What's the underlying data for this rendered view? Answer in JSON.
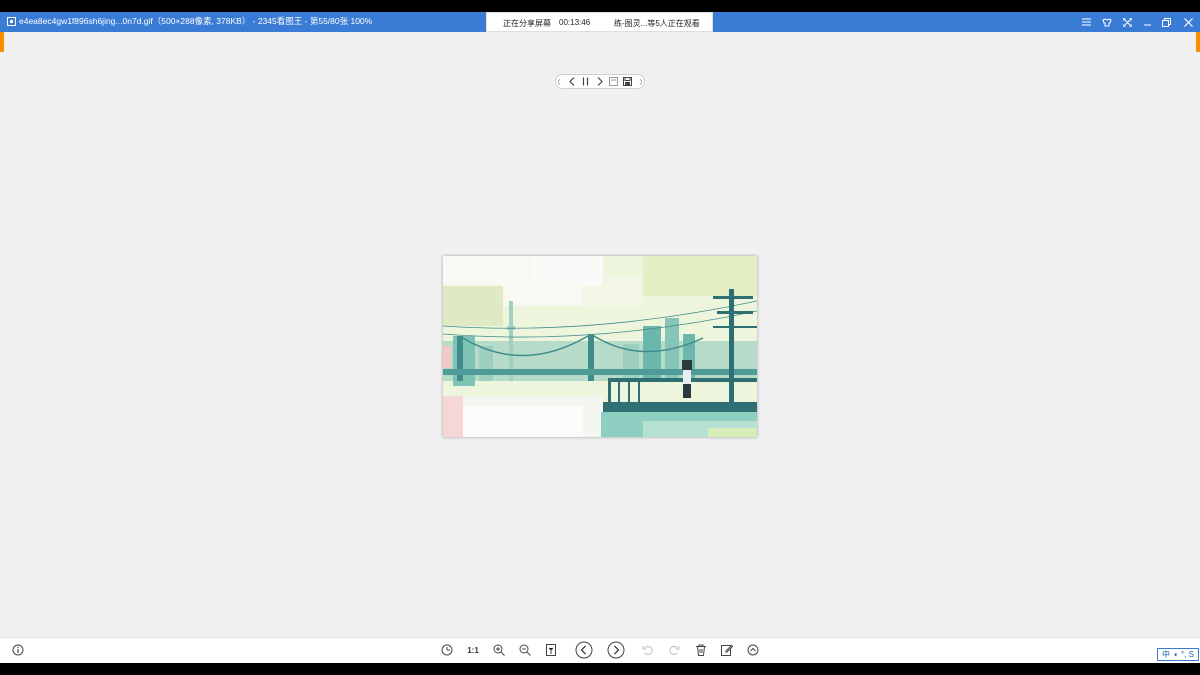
{
  "titlebar": {
    "title": "e4ea8ec4gw1f896sh6jing...0n7d.gif（500×288像素, 378KB） - 2345看图王 - 第55/80张 100%"
  },
  "share_panel": {
    "status": "正在分享屏幕",
    "timer": "00:13:46",
    "viewers": "练-图灵...等5人正在观看"
  },
  "window_controls": [
    "menu-icon",
    "skin-icon",
    "fullscreen-icon",
    "minimize-icon",
    "restore-icon",
    "close-icon"
  ],
  "floating_toolbar": [
    "left-grip-icon",
    "previous-icon",
    "pause-icon",
    "next-icon",
    "frame-icon",
    "save-icon",
    "right-grip-icon"
  ],
  "bottom_toolbar": {
    "info_icon": "info-icon",
    "actual_size_label": "1:1",
    "buttons": [
      "adapt-icon",
      "actual-size",
      "zoom-in-icon",
      "zoom-out-icon",
      "bookmark-icon",
      "previous-icon",
      "next-icon",
      "rotate-left-icon",
      "rotate-right-icon",
      "delete-icon",
      "edit-icon",
      "up-icon"
    ]
  },
  "ime": {
    "lang": "中",
    "glyphs": "◐ °, S"
  },
  "colors": {
    "titlebar": "#3a7bd5",
    "accent": "#ff8c00",
    "canvas": "#f0f0f0"
  }
}
